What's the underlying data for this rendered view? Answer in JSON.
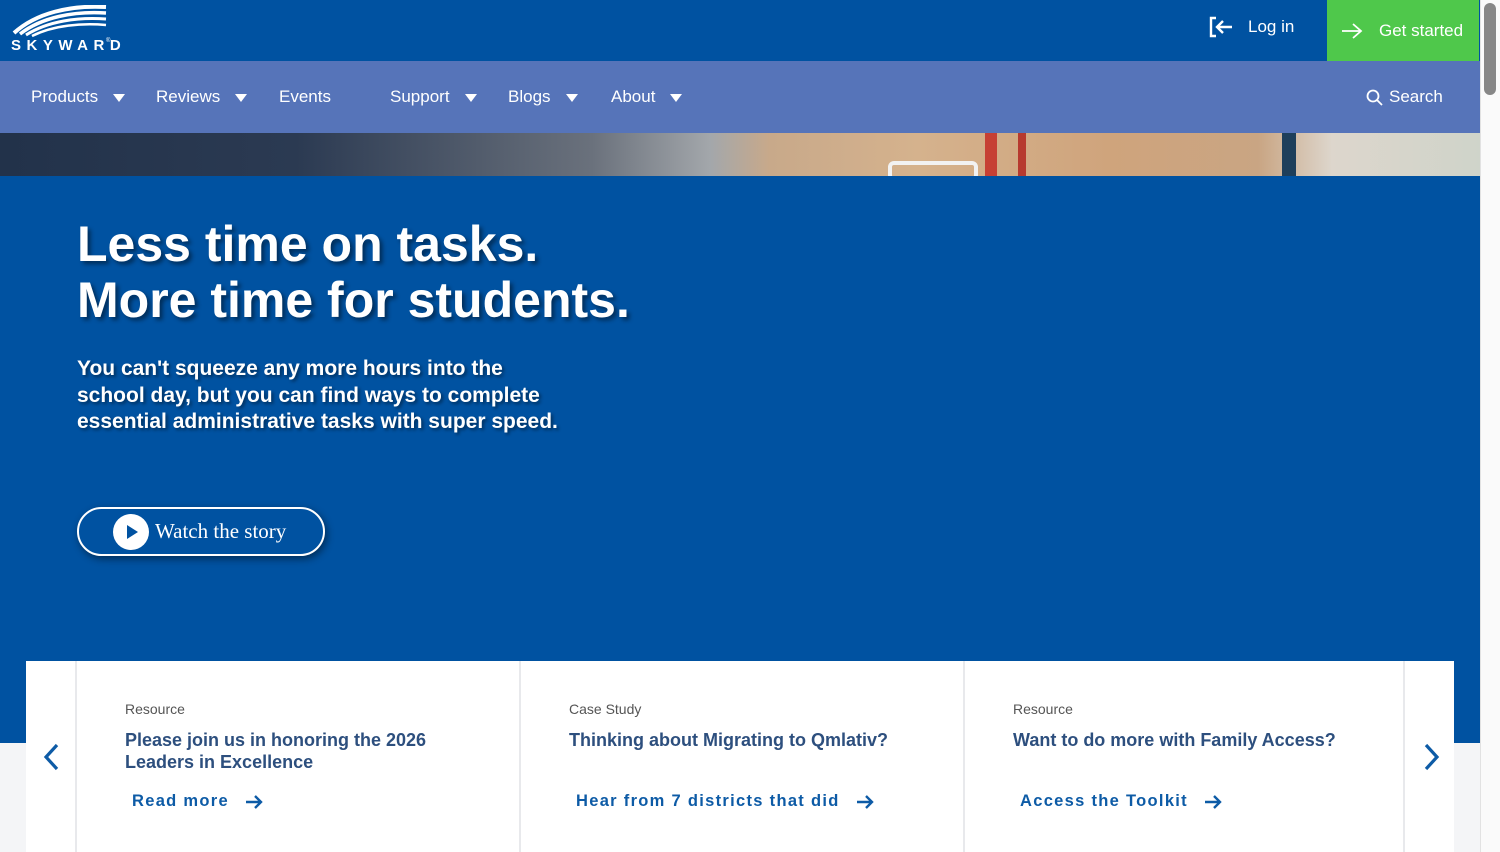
{
  "brand": {
    "name": "SKYWARD",
    "logo_icon": "skyward-swoosh-logo"
  },
  "topbar": {
    "login_label": "Log in",
    "login_icon": "login-arrow-icon",
    "get_started_label": "Get started",
    "get_started_icon": "arrow-right-icon"
  },
  "nav": {
    "items": [
      {
        "label": "Products",
        "has_dropdown": true
      },
      {
        "label": "Reviews",
        "has_dropdown": true
      },
      {
        "label": "Events",
        "has_dropdown": false
      },
      {
        "label": "Support",
        "has_dropdown": true
      },
      {
        "label": "Blogs",
        "has_dropdown": true
      },
      {
        "label": "About",
        "has_dropdown": true
      }
    ],
    "search_label": "Search",
    "search_icon": "search-icon"
  },
  "hero": {
    "title_line1": "Less time on tasks.",
    "title_line2": "More time for students.",
    "subtitle_line1": "You can't squeeze any more hours into the",
    "subtitle_line2": "school day, but you can find ways to complete",
    "subtitle_line3": "essential administrative tasks with super speed.",
    "watch_label": "Watch the story",
    "watch_icon": "play-icon"
  },
  "carousel": {
    "prev_icon": "chevron-left-icon",
    "next_icon": "chevron-right-icon",
    "cards": [
      {
        "type": "Resource",
        "title_line1": "Please join us in honoring the 2026",
        "title_line2": "Leaders in Excellence",
        "link": "Read more"
      },
      {
        "type": "Case Study",
        "title_line1": "Thinking about Migrating to Qmlativ?",
        "title_line2": "",
        "link": "Hear from 7 districts that did"
      },
      {
        "type": "Resource",
        "title_line1": "Want to do more with Family Access?",
        "title_line2": "",
        "link": "Access the Toolkit"
      }
    ]
  },
  "colors": {
    "primary": "#0052a1",
    "nav": "#5674b9",
    "cta": "#4fc84b",
    "card_title": "#2d4f7e",
    "link": "#0d5ba6"
  }
}
